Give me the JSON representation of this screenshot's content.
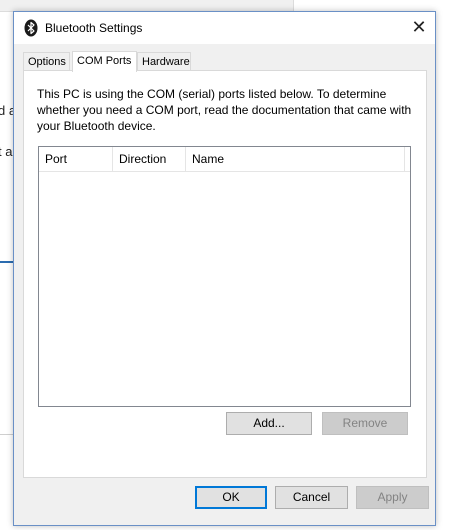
{
  "background": {
    "text_fragment_1": "d a",
    "text_fragment_2": "t a"
  },
  "dialog": {
    "title": "Bluetooth Settings",
    "title_icon": "bluetooth-icon",
    "close_glyph": "✕",
    "tabs": [
      {
        "label": "Options",
        "active": false
      },
      {
        "label": "COM Ports",
        "active": true
      },
      {
        "label": "Hardware",
        "active": false
      }
    ],
    "description": "This PC is using the COM (serial) ports listed below. To determine whether you need a COM port, read the documentation that came with your Bluetooth device.",
    "list": {
      "columns": [
        "Port",
        "Direction",
        "Name"
      ],
      "rows": []
    },
    "add_label": "Add...",
    "remove_label": "Remove",
    "ok_label": "OK",
    "cancel_label": "Cancel",
    "apply_label": "Apply"
  },
  "colors": {
    "accent": "#0078d7",
    "dialog_border": "#6a90c6",
    "disabled_text": "#838383"
  }
}
